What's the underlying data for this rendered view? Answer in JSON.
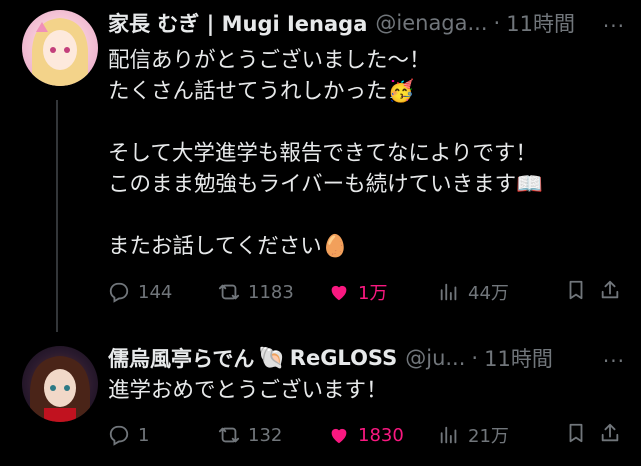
{
  "post1": {
    "name": "家長 むぎ | Mugi Ienaga",
    "handle": "@ienaga...",
    "dot": "·",
    "time": "11時間",
    "more": "···",
    "text": "配信ありがとうございました〜！\nたくさん話せてうれしかった🥳\n\nそして大学進学も報告できてなによりです！\nこのまま勉強もライバーも続けていきます📖\n\nまたお話してください🥚",
    "stats": {
      "replies": "144",
      "retweets": "1183",
      "likes": "1万",
      "views": "44万"
    },
    "liked": true,
    "avatar_icon": "vtuber-avatar"
  },
  "post2": {
    "name": "儒烏風亭らでん",
    "emoji": "🐚",
    "name_suffix": "ReGLOSS",
    "handle": "@ju...",
    "dot": "·",
    "time": "11時間",
    "more": "···",
    "text": "進学おめでとうございます！",
    "stats": {
      "replies": "1",
      "retweets": "132",
      "likes": "1830",
      "views": "21万"
    },
    "liked": true,
    "avatar_icon": "vtuber-avatar"
  },
  "colors": {
    "background": "#000000",
    "text": "#e7e9ea",
    "secondary": "#71767b",
    "like": "#f91880"
  }
}
